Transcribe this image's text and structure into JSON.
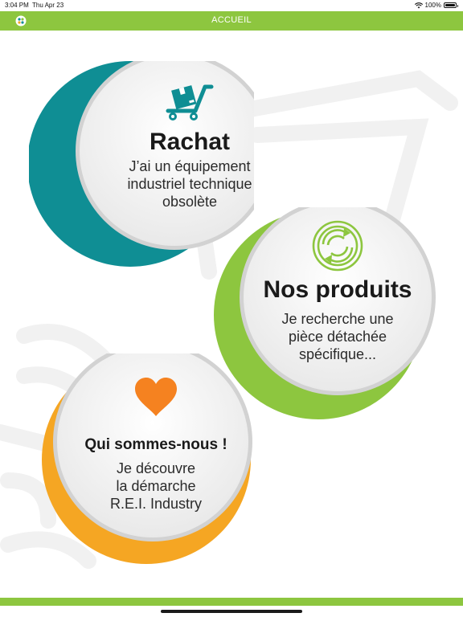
{
  "statusbar": {
    "time": "3:04 PM",
    "date": "Thu Apr 23",
    "battery": "100%"
  },
  "navbar": {
    "title": "ACCUEIL",
    "color": "#8dc63f"
  },
  "cards": {
    "rachat": {
      "title": "Rachat",
      "line1": "J’ai un équipement",
      "line2": "industriel technique",
      "line3": "obsolète",
      "icon": "hand-truck-box-icon",
      "color": "#0f8e94"
    },
    "produits": {
      "title": "Nos produits",
      "line1": "Je recherche une",
      "line2": "pièce détachée",
      "line3": "spécifique...",
      "icon": "recycle-circle-icon",
      "color": "#8dc63f"
    },
    "qui": {
      "title": "Qui sommes-nous !",
      "line1": "Je découvre",
      "line2": "la démarche",
      "line3": "R.E.I. Industry",
      "icon": "heart-icon",
      "color": "#f5a623"
    }
  }
}
